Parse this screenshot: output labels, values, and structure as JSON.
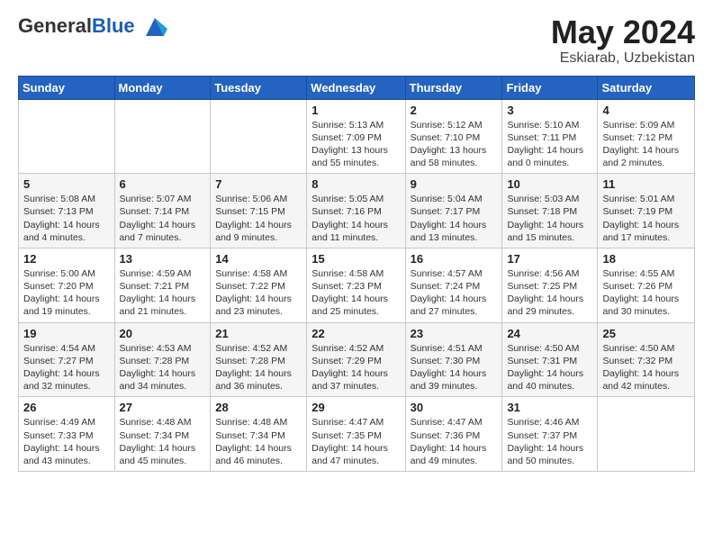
{
  "header": {
    "logo_general": "General",
    "logo_blue": "Blue",
    "month_year": "May 2024",
    "location": "Eskiarab, Uzbekistan"
  },
  "weekdays": [
    "Sunday",
    "Monday",
    "Tuesday",
    "Wednesday",
    "Thursday",
    "Friday",
    "Saturday"
  ],
  "weeks": [
    [
      {
        "day": "",
        "info": ""
      },
      {
        "day": "",
        "info": ""
      },
      {
        "day": "",
        "info": ""
      },
      {
        "day": "1",
        "info": "Sunrise: 5:13 AM\nSunset: 7:09 PM\nDaylight: 13 hours\nand 55 minutes."
      },
      {
        "day": "2",
        "info": "Sunrise: 5:12 AM\nSunset: 7:10 PM\nDaylight: 13 hours\nand 58 minutes."
      },
      {
        "day": "3",
        "info": "Sunrise: 5:10 AM\nSunset: 7:11 PM\nDaylight: 14 hours\nand 0 minutes."
      },
      {
        "day": "4",
        "info": "Sunrise: 5:09 AM\nSunset: 7:12 PM\nDaylight: 14 hours\nand 2 minutes."
      }
    ],
    [
      {
        "day": "5",
        "info": "Sunrise: 5:08 AM\nSunset: 7:13 PM\nDaylight: 14 hours\nand 4 minutes."
      },
      {
        "day": "6",
        "info": "Sunrise: 5:07 AM\nSunset: 7:14 PM\nDaylight: 14 hours\nand 7 minutes."
      },
      {
        "day": "7",
        "info": "Sunrise: 5:06 AM\nSunset: 7:15 PM\nDaylight: 14 hours\nand 9 minutes."
      },
      {
        "day": "8",
        "info": "Sunrise: 5:05 AM\nSunset: 7:16 PM\nDaylight: 14 hours\nand 11 minutes."
      },
      {
        "day": "9",
        "info": "Sunrise: 5:04 AM\nSunset: 7:17 PM\nDaylight: 14 hours\nand 13 minutes."
      },
      {
        "day": "10",
        "info": "Sunrise: 5:03 AM\nSunset: 7:18 PM\nDaylight: 14 hours\nand 15 minutes."
      },
      {
        "day": "11",
        "info": "Sunrise: 5:01 AM\nSunset: 7:19 PM\nDaylight: 14 hours\nand 17 minutes."
      }
    ],
    [
      {
        "day": "12",
        "info": "Sunrise: 5:00 AM\nSunset: 7:20 PM\nDaylight: 14 hours\nand 19 minutes."
      },
      {
        "day": "13",
        "info": "Sunrise: 4:59 AM\nSunset: 7:21 PM\nDaylight: 14 hours\nand 21 minutes."
      },
      {
        "day": "14",
        "info": "Sunrise: 4:58 AM\nSunset: 7:22 PM\nDaylight: 14 hours\nand 23 minutes."
      },
      {
        "day": "15",
        "info": "Sunrise: 4:58 AM\nSunset: 7:23 PM\nDaylight: 14 hours\nand 25 minutes."
      },
      {
        "day": "16",
        "info": "Sunrise: 4:57 AM\nSunset: 7:24 PM\nDaylight: 14 hours\nand 27 minutes."
      },
      {
        "day": "17",
        "info": "Sunrise: 4:56 AM\nSunset: 7:25 PM\nDaylight: 14 hours\nand 29 minutes."
      },
      {
        "day": "18",
        "info": "Sunrise: 4:55 AM\nSunset: 7:26 PM\nDaylight: 14 hours\nand 30 minutes."
      }
    ],
    [
      {
        "day": "19",
        "info": "Sunrise: 4:54 AM\nSunset: 7:27 PM\nDaylight: 14 hours\nand 32 minutes."
      },
      {
        "day": "20",
        "info": "Sunrise: 4:53 AM\nSunset: 7:28 PM\nDaylight: 14 hours\nand 34 minutes."
      },
      {
        "day": "21",
        "info": "Sunrise: 4:52 AM\nSunset: 7:28 PM\nDaylight: 14 hours\nand 36 minutes."
      },
      {
        "day": "22",
        "info": "Sunrise: 4:52 AM\nSunset: 7:29 PM\nDaylight: 14 hours\nand 37 minutes."
      },
      {
        "day": "23",
        "info": "Sunrise: 4:51 AM\nSunset: 7:30 PM\nDaylight: 14 hours\nand 39 minutes."
      },
      {
        "day": "24",
        "info": "Sunrise: 4:50 AM\nSunset: 7:31 PM\nDaylight: 14 hours\nand 40 minutes."
      },
      {
        "day": "25",
        "info": "Sunrise: 4:50 AM\nSunset: 7:32 PM\nDaylight: 14 hours\nand 42 minutes."
      }
    ],
    [
      {
        "day": "26",
        "info": "Sunrise: 4:49 AM\nSunset: 7:33 PM\nDaylight: 14 hours\nand 43 minutes."
      },
      {
        "day": "27",
        "info": "Sunrise: 4:48 AM\nSunset: 7:34 PM\nDaylight: 14 hours\nand 45 minutes."
      },
      {
        "day": "28",
        "info": "Sunrise: 4:48 AM\nSunset: 7:34 PM\nDaylight: 14 hours\nand 46 minutes."
      },
      {
        "day": "29",
        "info": "Sunrise: 4:47 AM\nSunset: 7:35 PM\nDaylight: 14 hours\nand 47 minutes."
      },
      {
        "day": "30",
        "info": "Sunrise: 4:47 AM\nSunset: 7:36 PM\nDaylight: 14 hours\nand 49 minutes."
      },
      {
        "day": "31",
        "info": "Sunrise: 4:46 AM\nSunset: 7:37 PM\nDaylight: 14 hours\nand 50 minutes."
      },
      {
        "day": "",
        "info": ""
      }
    ]
  ]
}
